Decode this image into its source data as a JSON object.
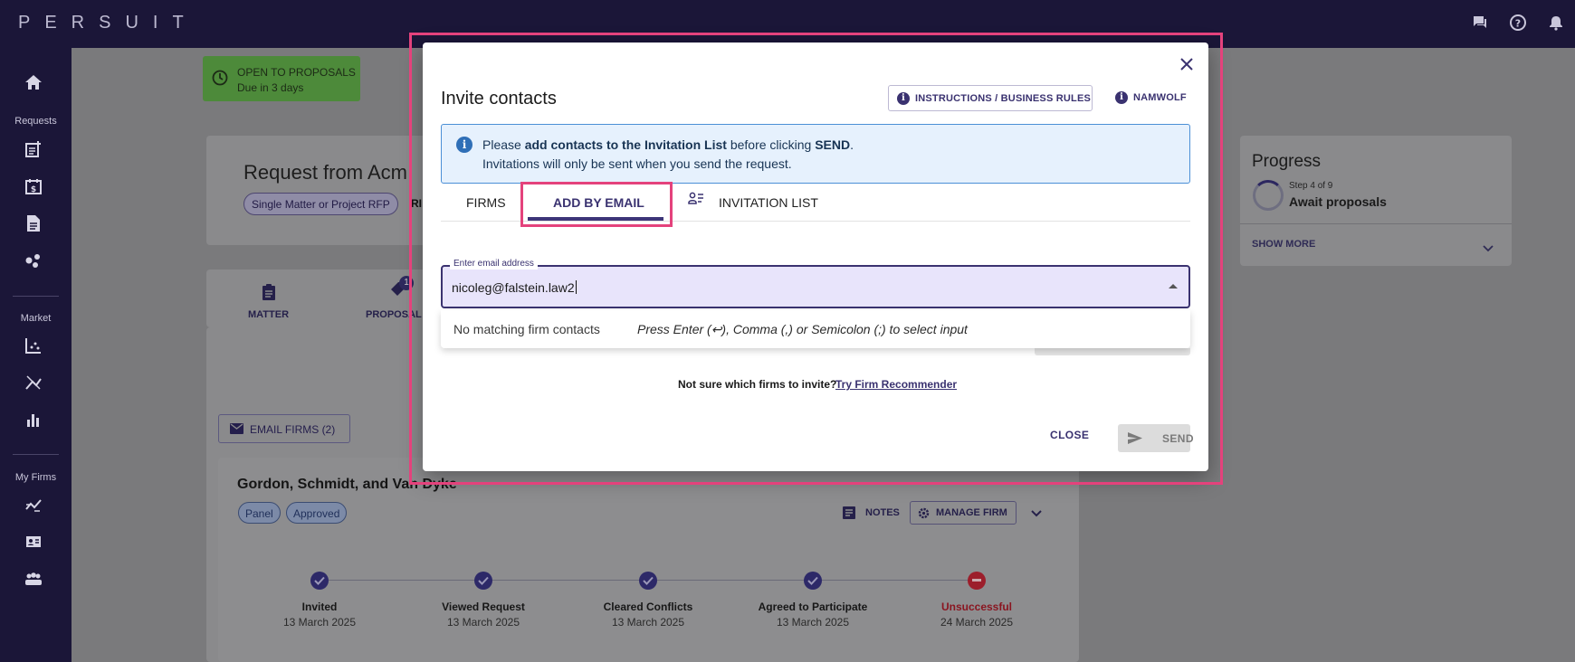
{
  "app": {
    "logo": "PERSUIT"
  },
  "sidebar": {
    "sections": [
      {
        "label": "Requests"
      },
      {
        "label": "Market"
      },
      {
        "label": "My Firms"
      }
    ]
  },
  "page": {
    "status": {
      "title": "OPEN TO PROPOSALS",
      "due": "Due in 3 days"
    },
    "request_title": "Request from Acm",
    "chips": [
      "Single Matter or Project RFP",
      "RI"
    ],
    "tabs": [
      "MATTER",
      "PROPOSAL"
    ],
    "proposal_badge": "1",
    "email_firms": "EMAIL FIRMS (2)",
    "firm": {
      "name": "Gordon, Schmidt, and Van Dyke",
      "tags": [
        "Panel",
        "Approved"
      ],
      "notes": "NOTES",
      "manage": "MANAGE FIRM",
      "steps": [
        {
          "label": "Invited",
          "date": "13 March 2025",
          "status": "done"
        },
        {
          "label": "Viewed Request",
          "date": "13 March 2025",
          "status": "done"
        },
        {
          "label": "Cleared Conflicts",
          "date": "13 March 2025",
          "status": "done"
        },
        {
          "label": "Agreed to Participate",
          "date": "13 March 2025",
          "status": "done"
        },
        {
          "label": "Unsuccessful",
          "date": "24 March 2025",
          "status": "failed"
        }
      ]
    },
    "progress": {
      "title": "Progress",
      "step": "Step 4 of 9",
      "name": "Await proposals",
      "show_more": "SHOW MORE"
    }
  },
  "dialog": {
    "title": "Invite contacts",
    "instructions_label": "INSTRUCTIONS / BUSINESS RULES",
    "namwolf_label": "NAMWOLF",
    "banner": {
      "line1_pre": "Please ",
      "line1_bold1": "add contacts to the Invitation List",
      "line1_mid": " before clicking ",
      "line1_bold2": "SEND",
      "line1_post": ".",
      "line2": "Invitations will only be sent when you send the request."
    },
    "tabs": {
      "firms": "FIRMS",
      "add_by_email": "ADD BY EMAIL",
      "invitation_list": "INVITATION LIST"
    },
    "email_field": {
      "label": "Enter email address",
      "value": "nicoleg@falstein.law2"
    },
    "dropdown": {
      "no_match": "No matching firm contacts",
      "hint": "Press Enter (↩), Comma (,) or Semicolon (;) to select input"
    },
    "recommender": {
      "question": "Not sure which firms to invite?",
      "link": "Try Firm Recommender"
    },
    "close_label": "CLOSE",
    "send_label": "SEND"
  },
  "colors": {
    "accent": "#3a3270",
    "highlight": "#e4427c",
    "banner_bg": "#e6f1fd",
    "sidebar": "#1b1638"
  }
}
